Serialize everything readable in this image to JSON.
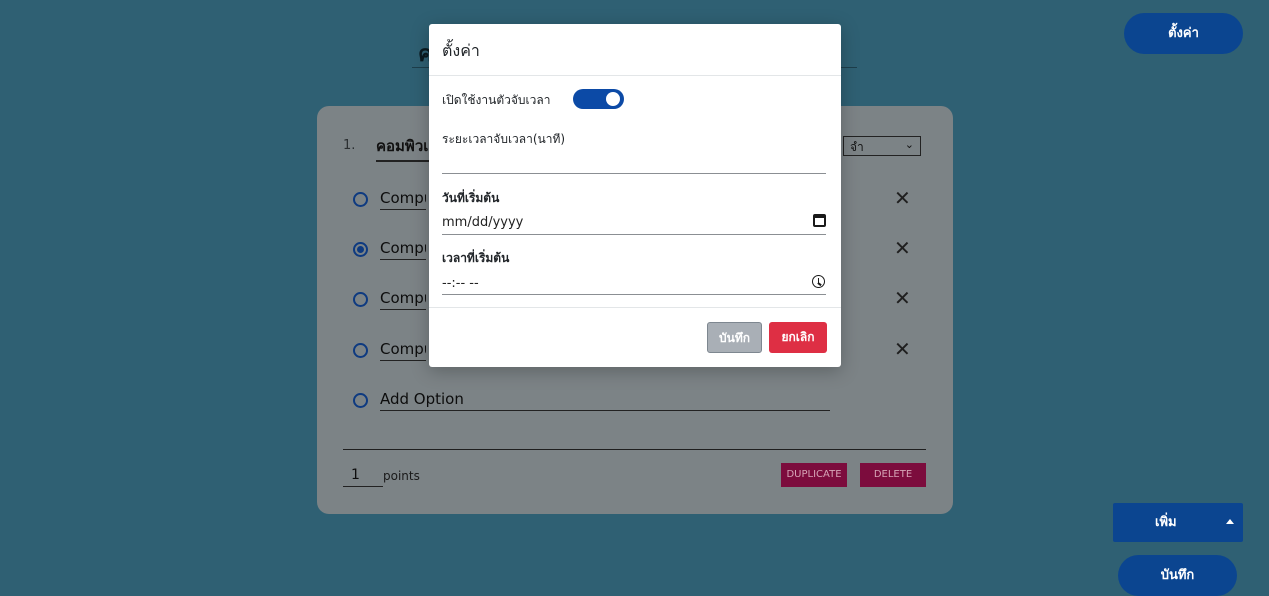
{
  "header": {
    "title_visible": "ค",
    "settings_label": "ตั้งค่า"
  },
  "question": {
    "number": "1.",
    "title_visible": "คอมพิวเ",
    "type_select_visible": "จำ",
    "options": [
      {
        "text": "Compu",
        "selected": false
      },
      {
        "text": "Compu",
        "selected": true
      },
      {
        "text": "Compu",
        "selected": false
      },
      {
        "text": "Compu",
        "selected": false
      }
    ],
    "add_option_label": "Add Option",
    "points_value": "1",
    "points_label": "points",
    "duplicate_label": "DUPLICATE",
    "delete_label": "DELETE"
  },
  "footer": {
    "add_label": "เพิ่ม",
    "save_label": "บันทึก"
  },
  "modal": {
    "title": "ตั้งค่า",
    "enable_timer_label": "เปิดใช้งานตัวจับเวลา",
    "timer_enabled": true,
    "duration_label": "ระยะเวลาจับเวลา(นาที)",
    "duration_value": "",
    "start_date_label": "วันที่เริ่มต้น",
    "start_date_placeholder": "mm/dd/yyyy",
    "start_time_label": "เวลาที่เริ่มต้น",
    "start_time_placeholder": "--:-- --",
    "save_label": "บันทึก",
    "cancel_label": "ยกเลิก"
  },
  "colors": {
    "background": "#2f6073",
    "primary": "#0b4590",
    "danger": "#de2f44",
    "card_overlay": "#7c8386",
    "toggle_on": "#0c4aa6"
  }
}
